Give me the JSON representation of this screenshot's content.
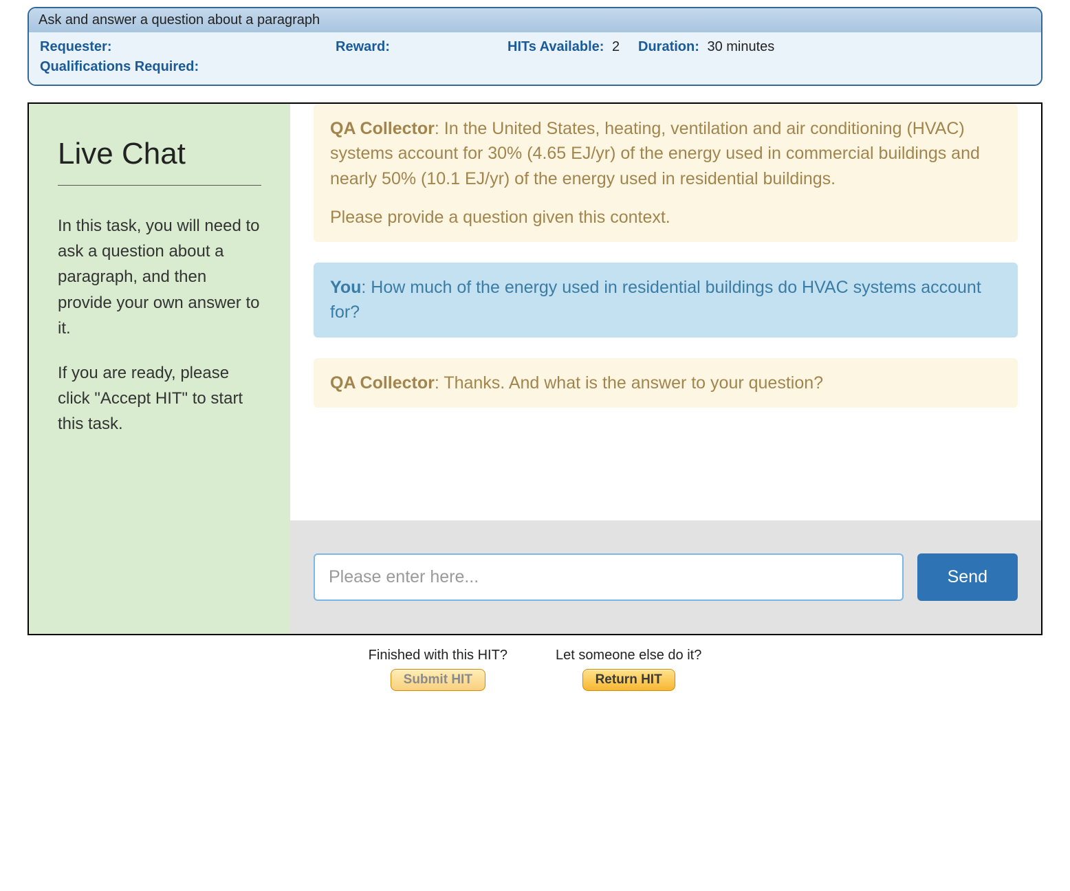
{
  "hit_header": {
    "title": "Ask and answer a question about a paragraph",
    "requester_label": "Requester:",
    "requester_value": "",
    "reward_label": "Reward:",
    "reward_value": "",
    "hits_available_label": "HITs Available:",
    "hits_available_value": "2",
    "duration_label": "Duration:",
    "duration_value": "30 minutes",
    "qualifications_label": "Qualifications Required:",
    "qualifications_value": ""
  },
  "sidebar": {
    "heading": "Live Chat",
    "para1": "In this task, you will need to ask a question about a paragraph, and then provide your own answer to it.",
    "para2": "If you are ready, please click \"Accept HIT\" to start this task."
  },
  "chat": {
    "messages": [
      {
        "role": "bot",
        "sender": "QA Collector",
        "text": "In the United States, heating, ventilation and air conditioning (HVAC) systems account for 30% (4.65 EJ/yr) of the energy used in commercial buildings and nearly 50% (10.1 EJ/yr) of the energy used in residential buildings.",
        "followup": "Please provide a question given this context."
      },
      {
        "role": "you",
        "sender": "You",
        "text": "How much of the energy used in residential buildings do HVAC systems account for?"
      },
      {
        "role": "bot",
        "sender": "QA Collector",
        "text": "Thanks. And what is the answer to your question?"
      }
    ],
    "input_placeholder": "Please enter here...",
    "send_label": "Send"
  },
  "footer": {
    "finished_prompt": "Finished with this HIT?",
    "submit_label": "Submit HIT",
    "else_prompt": "Let someone else do it?",
    "return_label": "Return HIT"
  }
}
